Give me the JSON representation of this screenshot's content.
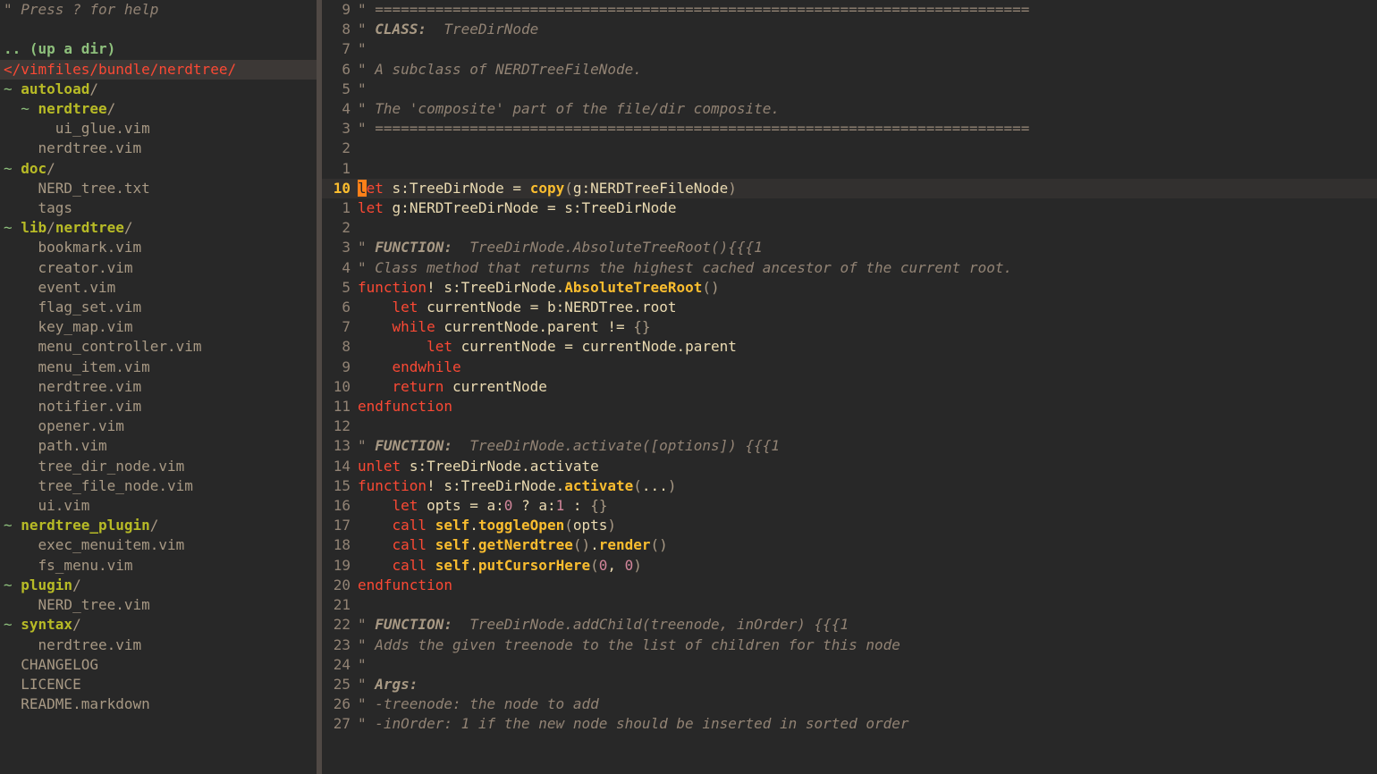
{
  "sidebar": {
    "help": "\" Press ? for help",
    "updir": ".. (up a dir)",
    "rootpath": "</vimfiles/bundle/nerdtree/",
    "entries": [
      {
        "indent": 0,
        "type": "dir",
        "prefix": "~ ",
        "name": "autoload",
        "suffix": "/"
      },
      {
        "indent": 1,
        "type": "dir",
        "prefix": "~ ",
        "name": "nerdtree",
        "suffix": "/"
      },
      {
        "indent": 2,
        "type": "file",
        "name": "ui_glue.vim"
      },
      {
        "indent": 1,
        "type": "file",
        "name": "nerdtree.vim"
      },
      {
        "indent": 0,
        "type": "dir",
        "prefix": "~ ",
        "name": "doc",
        "suffix": "/"
      },
      {
        "indent": 1,
        "type": "file",
        "name": "NERD_tree.txt"
      },
      {
        "indent": 1,
        "type": "file",
        "name": "tags"
      },
      {
        "indent": 0,
        "type": "dirpath",
        "prefix": "~ ",
        "name": "lib",
        "sub": "nerdtree",
        "suffix": "/"
      },
      {
        "indent": 1,
        "type": "file",
        "name": "bookmark.vim"
      },
      {
        "indent": 1,
        "type": "file",
        "name": "creator.vim"
      },
      {
        "indent": 1,
        "type": "file",
        "name": "event.vim"
      },
      {
        "indent": 1,
        "type": "file",
        "name": "flag_set.vim"
      },
      {
        "indent": 1,
        "type": "file",
        "name": "key_map.vim"
      },
      {
        "indent": 1,
        "type": "file",
        "name": "menu_controller.vim"
      },
      {
        "indent": 1,
        "type": "file",
        "name": "menu_item.vim"
      },
      {
        "indent": 1,
        "type": "file",
        "name": "nerdtree.vim"
      },
      {
        "indent": 1,
        "type": "file",
        "name": "notifier.vim"
      },
      {
        "indent": 1,
        "type": "file",
        "name": "opener.vim"
      },
      {
        "indent": 1,
        "type": "file",
        "name": "path.vim"
      },
      {
        "indent": 1,
        "type": "file",
        "name": "tree_dir_node.vim"
      },
      {
        "indent": 1,
        "type": "file",
        "name": "tree_file_node.vim"
      },
      {
        "indent": 1,
        "type": "file",
        "name": "ui.vim"
      },
      {
        "indent": 0,
        "type": "dir",
        "prefix": "~ ",
        "name": "nerdtree_plugin",
        "suffix": "/"
      },
      {
        "indent": 1,
        "type": "file",
        "name": "exec_menuitem.vim"
      },
      {
        "indent": 1,
        "type": "file",
        "name": "fs_menu.vim"
      },
      {
        "indent": 0,
        "type": "dir",
        "prefix": "~ ",
        "name": "plugin",
        "suffix": "/"
      },
      {
        "indent": 1,
        "type": "file",
        "name": "NERD_tree.vim"
      },
      {
        "indent": 0,
        "type": "dir",
        "prefix": "~ ",
        "name": "syntax",
        "suffix": "/"
      },
      {
        "indent": 1,
        "type": "file",
        "name": "nerdtree.vim"
      },
      {
        "indent": 0,
        "type": "file",
        "name": "CHANGELOG"
      },
      {
        "indent": 0,
        "type": "file",
        "name": "LICENCE"
      },
      {
        "indent": 0,
        "type": "file",
        "name": "README.markdown"
      }
    ]
  },
  "code": {
    "lines": [
      {
        "rn": "9",
        "t": "comment",
        "text": "\" ============================================================================"
      },
      {
        "rn": "8",
        "t": "comment",
        "spans": [
          "\" ",
          [
            "b",
            "CLASS:"
          ],
          "  TreeDirNode"
        ]
      },
      {
        "rn": "7",
        "t": "comment",
        "text": "\""
      },
      {
        "rn": "6",
        "t": "comment",
        "text": "\" A subclass of NERDTreeFileNode."
      },
      {
        "rn": "5",
        "t": "comment",
        "text": "\""
      },
      {
        "rn": "4",
        "t": "comment",
        "text": "\" The 'composite' part of the file/dir composite."
      },
      {
        "rn": "3",
        "t": "comment",
        "text": "\" ============================================================================"
      },
      {
        "rn": "2",
        "t": "blank"
      },
      {
        "rn": "1",
        "t": "blank"
      },
      {
        "rn": "10",
        "cursor": true,
        "t": "code",
        "tokens": [
          [
            "cursor",
            "l"
          ],
          [
            "kw",
            "et"
          ],
          [
            "sp",
            " "
          ],
          [
            "id",
            "s:TreeDirNode"
          ],
          [
            "sp",
            " "
          ],
          [
            "op",
            "="
          ],
          [
            "sp",
            " "
          ],
          [
            "func",
            "copy"
          ],
          [
            "paren",
            "("
          ],
          [
            "id",
            "g:NERDTreeFileNode"
          ],
          [
            "paren",
            ")"
          ]
        ]
      },
      {
        "rn": "1",
        "t": "code",
        "tokens": [
          [
            "kw",
            "let"
          ],
          [
            "sp",
            " "
          ],
          [
            "id",
            "g:NERDTreeDirNode"
          ],
          [
            "sp",
            " "
          ],
          [
            "op",
            "="
          ],
          [
            "sp",
            " "
          ],
          [
            "id",
            "s:TreeDirNode"
          ]
        ]
      },
      {
        "rn": "2",
        "t": "blank"
      },
      {
        "rn": "3",
        "t": "comment",
        "spans": [
          "\" ",
          [
            "b",
            "FUNCTION:"
          ],
          "  TreeDirNode.AbsoluteTreeRoot(){{{1"
        ]
      },
      {
        "rn": "4",
        "t": "comment",
        "text": "\" Class method that returns the highest cached ancestor of the current root."
      },
      {
        "rn": "5",
        "t": "code",
        "tokens": [
          [
            "kw",
            "function"
          ],
          [
            "op",
            "!"
          ],
          [
            "sp",
            " "
          ],
          [
            "id",
            "s:TreeDirNode"
          ],
          [
            "op",
            "."
          ],
          [
            "func",
            "AbsoluteTreeRoot"
          ],
          [
            "paren",
            "()"
          ]
        ]
      },
      {
        "rn": "6",
        "t": "code",
        "tokens": [
          [
            "sp",
            "    "
          ],
          [
            "kw",
            "let"
          ],
          [
            "sp",
            " "
          ],
          [
            "id",
            "currentNode"
          ],
          [
            "sp",
            " "
          ],
          [
            "op",
            "="
          ],
          [
            "sp",
            " "
          ],
          [
            "id",
            "b:NERDTree"
          ],
          [
            "op",
            "."
          ],
          [
            "field",
            "root"
          ]
        ]
      },
      {
        "rn": "7",
        "t": "code",
        "tokens": [
          [
            "sp",
            "    "
          ],
          [
            "kw",
            "while"
          ],
          [
            "sp",
            " "
          ],
          [
            "id",
            "currentNode"
          ],
          [
            "op",
            "."
          ],
          [
            "field",
            "parent"
          ],
          [
            "sp",
            " "
          ],
          [
            "op",
            "!="
          ],
          [
            "sp",
            " "
          ],
          [
            "brace",
            "{}"
          ]
        ]
      },
      {
        "rn": "8",
        "t": "code",
        "tokens": [
          [
            "sp",
            "        "
          ],
          [
            "kw",
            "let"
          ],
          [
            "sp",
            " "
          ],
          [
            "id",
            "currentNode"
          ],
          [
            "sp",
            " "
          ],
          [
            "op",
            "="
          ],
          [
            "sp",
            " "
          ],
          [
            "id",
            "currentNode"
          ],
          [
            "op",
            "."
          ],
          [
            "field",
            "parent"
          ]
        ]
      },
      {
        "rn": "9",
        "t": "code",
        "tokens": [
          [
            "sp",
            "    "
          ],
          [
            "kw",
            "endwhile"
          ]
        ]
      },
      {
        "rn": "10",
        "t": "code",
        "tokens": [
          [
            "sp",
            "    "
          ],
          [
            "kw",
            "return"
          ],
          [
            "sp",
            " "
          ],
          [
            "id",
            "currentNode"
          ]
        ]
      },
      {
        "rn": "11",
        "t": "code",
        "tokens": [
          [
            "kw",
            "endfunction"
          ]
        ]
      },
      {
        "rn": "12",
        "t": "blank"
      },
      {
        "rn": "13",
        "t": "comment",
        "spans": [
          "\" ",
          [
            "b",
            "FUNCTION:"
          ],
          "  TreeDirNode.activate([options]) {{{1"
        ]
      },
      {
        "rn": "14",
        "t": "code",
        "tokens": [
          [
            "kw",
            "unlet"
          ],
          [
            "sp",
            " "
          ],
          [
            "id",
            "s:TreeDirNode"
          ],
          [
            "op",
            "."
          ],
          [
            "field",
            "activate"
          ]
        ]
      },
      {
        "rn": "15",
        "t": "code",
        "tokens": [
          [
            "kw",
            "function"
          ],
          [
            "op",
            "!"
          ],
          [
            "sp",
            " "
          ],
          [
            "id",
            "s:TreeDirNode"
          ],
          [
            "op",
            "."
          ],
          [
            "func",
            "activate"
          ],
          [
            "paren",
            "("
          ],
          [
            "op",
            "..."
          ],
          [
            "paren",
            ")"
          ]
        ]
      },
      {
        "rn": "16",
        "t": "code",
        "tokens": [
          [
            "sp",
            "    "
          ],
          [
            "kw",
            "let"
          ],
          [
            "sp",
            " "
          ],
          [
            "id",
            "opts"
          ],
          [
            "sp",
            " "
          ],
          [
            "op",
            "="
          ],
          [
            "sp",
            " "
          ],
          [
            "id",
            "a:"
          ],
          [
            "num",
            "0"
          ],
          [
            "sp",
            " "
          ],
          [
            "op",
            "?"
          ],
          [
            "sp",
            " "
          ],
          [
            "id",
            "a:"
          ],
          [
            "num",
            "1"
          ],
          [
            "sp",
            " "
          ],
          [
            "op",
            ":"
          ],
          [
            "sp",
            " "
          ],
          [
            "brace",
            "{}"
          ]
        ]
      },
      {
        "rn": "17",
        "t": "code",
        "tokens": [
          [
            "sp",
            "    "
          ],
          [
            "kw",
            "call"
          ],
          [
            "sp",
            " "
          ],
          [
            "func",
            "self"
          ],
          [
            "op",
            "."
          ],
          [
            "func",
            "toggleOpen"
          ],
          [
            "paren",
            "("
          ],
          [
            "id",
            "opts"
          ],
          [
            "paren",
            ")"
          ]
        ]
      },
      {
        "rn": "18",
        "t": "code",
        "tokens": [
          [
            "sp",
            "    "
          ],
          [
            "kw",
            "call"
          ],
          [
            "sp",
            " "
          ],
          [
            "func",
            "self"
          ],
          [
            "op",
            "."
          ],
          [
            "func",
            "getNerdtree"
          ],
          [
            "paren",
            "()"
          ],
          [
            "op",
            "."
          ],
          [
            "func",
            "render"
          ],
          [
            "paren",
            "()"
          ]
        ]
      },
      {
        "rn": "19",
        "t": "code",
        "tokens": [
          [
            "sp",
            "    "
          ],
          [
            "kw",
            "call"
          ],
          [
            "sp",
            " "
          ],
          [
            "func",
            "self"
          ],
          [
            "op",
            "."
          ],
          [
            "func",
            "putCursorHere"
          ],
          [
            "paren",
            "("
          ],
          [
            "num",
            "0"
          ],
          [
            "op",
            ", "
          ],
          [
            "num",
            "0"
          ],
          [
            "paren",
            ")"
          ]
        ]
      },
      {
        "rn": "20",
        "t": "code",
        "tokens": [
          [
            "kw",
            "endfunction"
          ]
        ]
      },
      {
        "rn": "21",
        "t": "blank"
      },
      {
        "rn": "22",
        "t": "comment",
        "spans": [
          "\" ",
          [
            "b",
            "FUNCTION:"
          ],
          "  TreeDirNode.addChild(treenode, inOrder) {{{1"
        ]
      },
      {
        "rn": "23",
        "t": "comment",
        "text": "\" Adds the given treenode to the list of children for this node"
      },
      {
        "rn": "24",
        "t": "comment",
        "text": "\""
      },
      {
        "rn": "25",
        "t": "comment",
        "spans": [
          "\" ",
          [
            "b",
            "Args:"
          ]
        ]
      },
      {
        "rn": "26",
        "t": "comment",
        "text": "\" -treenode: the node to add"
      },
      {
        "rn": "27",
        "t": "comment",
        "text": "\" -inOrder: 1 if the new node should be inserted in sorted order"
      }
    ]
  }
}
